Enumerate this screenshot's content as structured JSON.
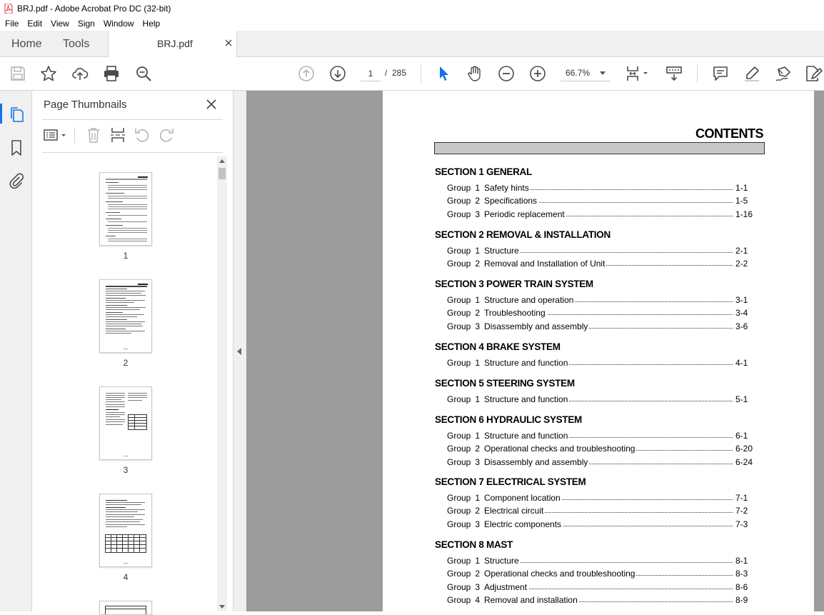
{
  "window": {
    "title": "BRJ.pdf - Adobe Acrobat Pro DC (32-bit)"
  },
  "menu": [
    "File",
    "Edit",
    "View",
    "Sign",
    "Window",
    "Help"
  ],
  "tabs": {
    "home": "Home",
    "tools": "Tools",
    "document": "BRJ.pdf"
  },
  "toolbar": {
    "current_page": "1",
    "page_separator": "/",
    "total_pages": "285",
    "zoom": "66.7%"
  },
  "thumbnails": {
    "title": "Page Thumbnails",
    "pages": [
      "1",
      "2",
      "3",
      "4"
    ]
  },
  "document": {
    "contents_title": "CONTENTS",
    "group_word": "Group",
    "sections": [
      {
        "heading": "SECTION 1  GENERAL",
        "groups": [
          {
            "num": "1",
            "name": "Safety hints",
            "page": "1-1"
          },
          {
            "num": "2",
            "name": "Specifications",
            "page": "1-5"
          },
          {
            "num": "3",
            "name": "Periodic replacement",
            "page": "1-16"
          }
        ]
      },
      {
        "heading": "SECTION 2  REMOVAL & INSTALLATION",
        "groups": [
          {
            "num": "1",
            "name": "Structure",
            "page": "2-1"
          },
          {
            "num": "2",
            "name": "Removal and Installation of Unit",
            "page": "2-2"
          }
        ]
      },
      {
        "heading": "SECTION 3  POWER TRAIN SYSTEM",
        "groups": [
          {
            "num": "1",
            "name": "Structure and operation",
            "page": "3-1"
          },
          {
            "num": "2",
            "name": "Troubleshooting",
            "page": "3-4"
          },
          {
            "num": "3",
            "name": "Disassembly and assembly",
            "page": "3-6"
          }
        ]
      },
      {
        "heading": "SECTION 4  BRAKE SYSTEM",
        "groups": [
          {
            "num": "1",
            "name": "Structure and function",
            "page": "4-1"
          }
        ]
      },
      {
        "heading": "SECTION 5  STEERING SYSTEM",
        "groups": [
          {
            "num": "1",
            "name": "Structure and function",
            "page": "5-1"
          }
        ]
      },
      {
        "heading": "SECTION 6  HYDRAULIC SYSTEM",
        "groups": [
          {
            "num": "1",
            "name": "Structure and function",
            "page": "6-1"
          },
          {
            "num": "2",
            "name": "Operational checks and troubleshooting",
            "page": "6-20"
          },
          {
            "num": "3",
            "name": "Disassembly and assembly",
            "page": "6-24"
          }
        ]
      },
      {
        "heading": "SECTION 7  ELECTRICAL SYSTEM",
        "groups": [
          {
            "num": "1",
            "name": "Component location",
            "page": "7-1"
          },
          {
            "num": "2",
            "name": "Electrical circuit",
            "page": "7-2"
          },
          {
            "num": "3",
            "name": "Electric components",
            "page": "7-3"
          }
        ]
      },
      {
        "heading": "SECTION 8  MAST",
        "groups": [
          {
            "num": "1",
            "name": "Structure",
            "page": "8-1"
          },
          {
            "num": "2",
            "name": "Operational checks and troubleshooting",
            "page": "8-3"
          },
          {
            "num": "3",
            "name": "Adjustment",
            "page": "8-6"
          },
          {
            "num": "4",
            "name": "Removal and installation",
            "page": "8-9"
          }
        ]
      }
    ]
  },
  "colors": {
    "accent": "#1473e6",
    "viewport_bg": "#9c9c9c",
    "acrobat_red": "#d7373f"
  }
}
